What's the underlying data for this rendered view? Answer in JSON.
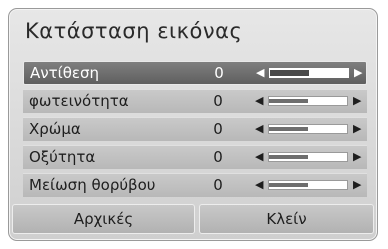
{
  "dialog": {
    "title": "Κατάσταση εικόνας",
    "items": [
      {
        "label": "Αντίθεση",
        "value": "0",
        "level": 0.5,
        "selected": true
      },
      {
        "label": "φωτεινότητα",
        "value": "0",
        "level": 0.5,
        "selected": false
      },
      {
        "label": "Χρώμα",
        "value": "0",
        "level": 0.5,
        "selected": false
      },
      {
        "label": "Οξύτητα",
        "value": "0",
        "level": 0.5,
        "selected": false
      },
      {
        "label": "Μείωση θορύβου",
        "value": "0",
        "level": 0.5,
        "selected": false
      }
    ],
    "arrow_left": "◀",
    "arrow_right": "▶",
    "buttons": {
      "reset_label": "Αρχικές",
      "close_label": "Κλείν"
    }
  }
}
